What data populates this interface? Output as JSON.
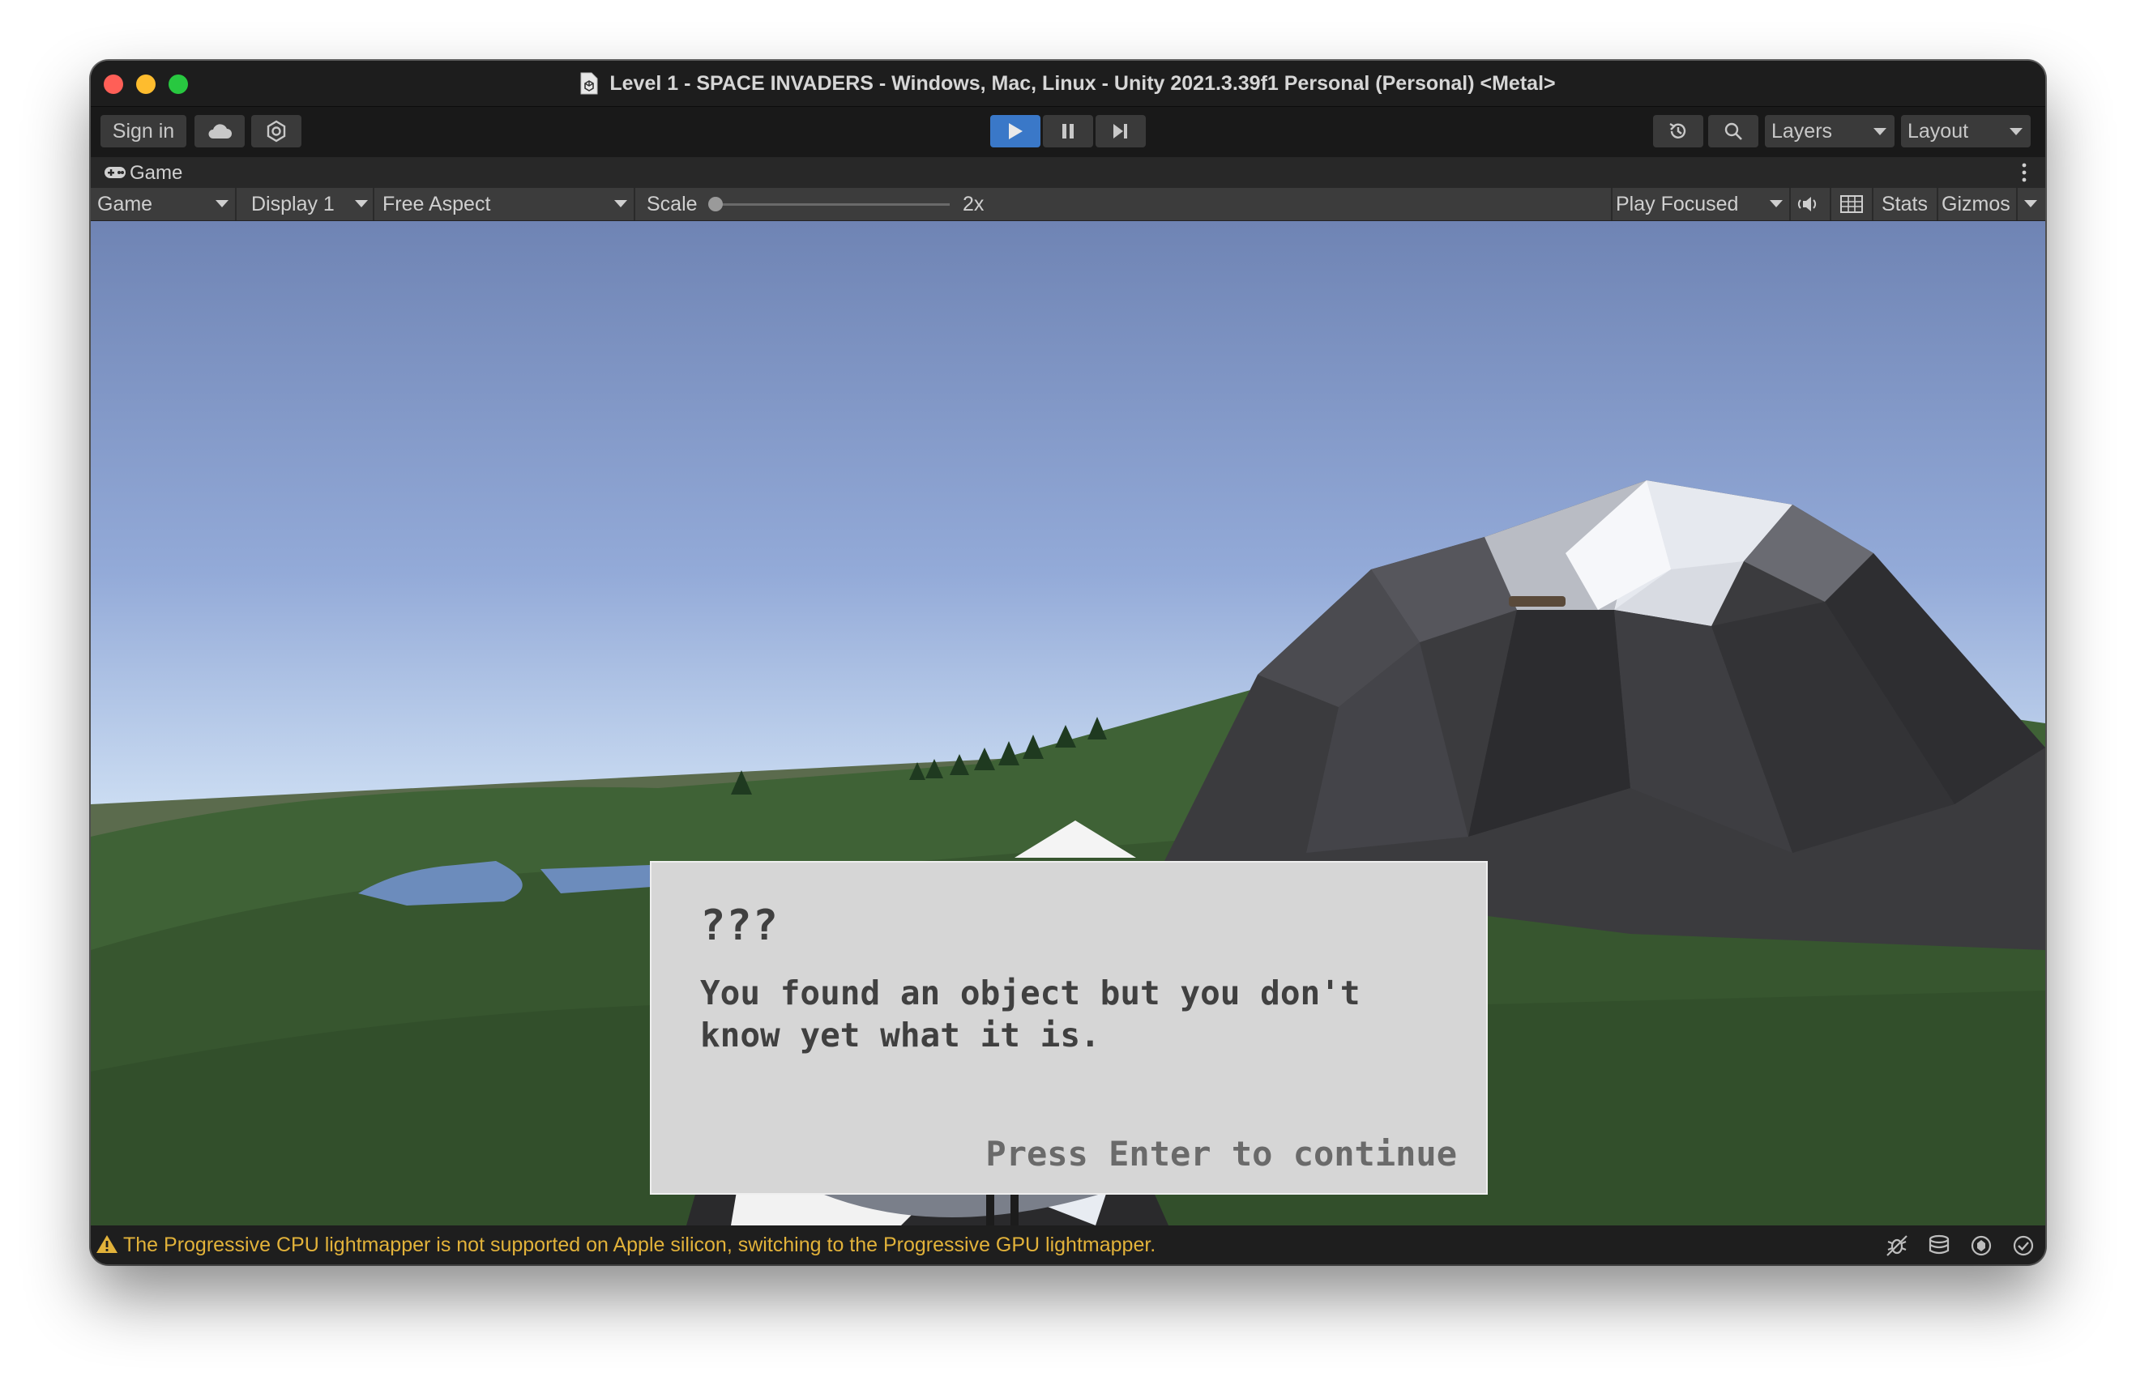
{
  "window": {
    "title": "Level 1 - SPACE INVADERS - Windows, Mac, Linux - Unity 2021.3.39f1 Personal (Personal) <Metal>"
  },
  "toolbar": {
    "sign_in_label": "Sign in",
    "layers_label": "Layers",
    "layout_label": "Layout"
  },
  "game_tab": {
    "label": "Game"
  },
  "game_bar": {
    "mode_label": "Game",
    "display_label": "Display 1",
    "aspect_label": "Free Aspect",
    "scale_label": "Scale",
    "scale_value": "2x",
    "play_focus_label": "Play Focused",
    "stats_label": "Stats",
    "gizmos_label": "Gizmos"
  },
  "dialog": {
    "speaker": "???",
    "message": "You found an object but you don't know yet what it is.",
    "hint": "Press Enter to continue"
  },
  "status": {
    "message": "The Progressive CPU lightmapper is not supported on Apple silicon, switching to the Progressive GPU lightmapper."
  },
  "colors": {
    "play_active": "#3a78c8",
    "warning": "#e2b23a",
    "dialog_bg": "#d6d6d6"
  }
}
